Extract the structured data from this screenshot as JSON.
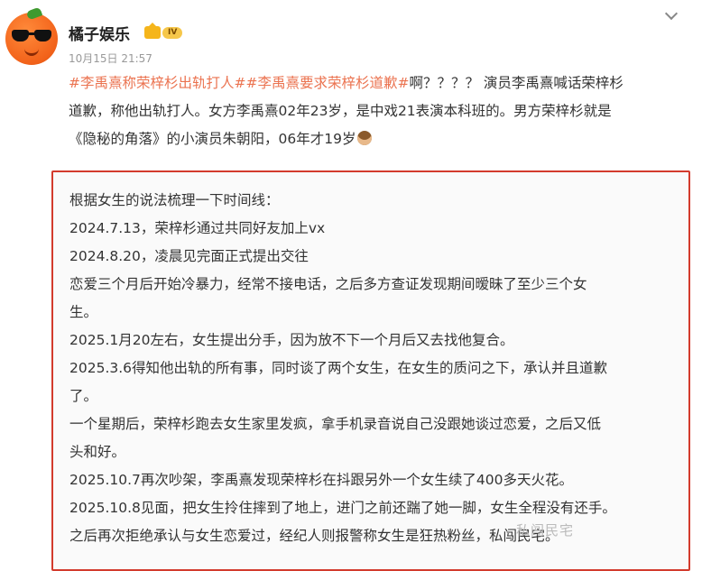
{
  "author": {
    "name": "橘子娱乐",
    "badge": "IV"
  },
  "post": {
    "time": "10月15日 21:57",
    "hashtag1": "#李禹熹称荣梓杉出轨打人#",
    "hashtag2": "#李禹熹要求荣梓杉道歉#",
    "line1_tail": "啊？？？？ 演员李禹熹喊话荣梓杉",
    "line2": "道歉，称他出轨打人。女方李禹熹02年23岁，是中戏21表演本科班的。男方荣梓杉就是",
    "line3": "《隐秘的角落》的小演员朱朝阳，06年才19岁"
  },
  "timeline_lines": [
    "根据女生的说法梳理一下时间线：",
    "2024.7.13，荣梓杉通过共同好友加上vx",
    "2024.8.20，凌晨见完面正式提出交往",
    "恋爱三个月后开始冷暴力，经常不接电话，之后多方查证发现期间暧昧了至少三个女",
    "生。",
    "2025.1月20左右，女生提出分手，因为放不下一个月后又去找他复合。",
    "2025.3.6得知他出轨的所有事，同时谈了两个女生，在女生的质问之下，承认并且道歉",
    "了。",
    "一个星期后，荣梓杉跑去女生家里发疯，拿手机录音说自己没跟她谈过恋爱，之后又低",
    "头和好。",
    "2025.10.7再次吵架，李禹熹发现荣梓杉在抖跟另外一个女生续了400多天火花。",
    "2025.10.8见面，把女生拎住摔到了地上，进门之前还踹了她一脚，女生全程没有还手。",
    "之后再次拒绝承认与女生恋爱过，经纪人则报警称女生是狂热粉丝，私闯民宅。"
  ],
  "watermark": "私闯民宅"
}
